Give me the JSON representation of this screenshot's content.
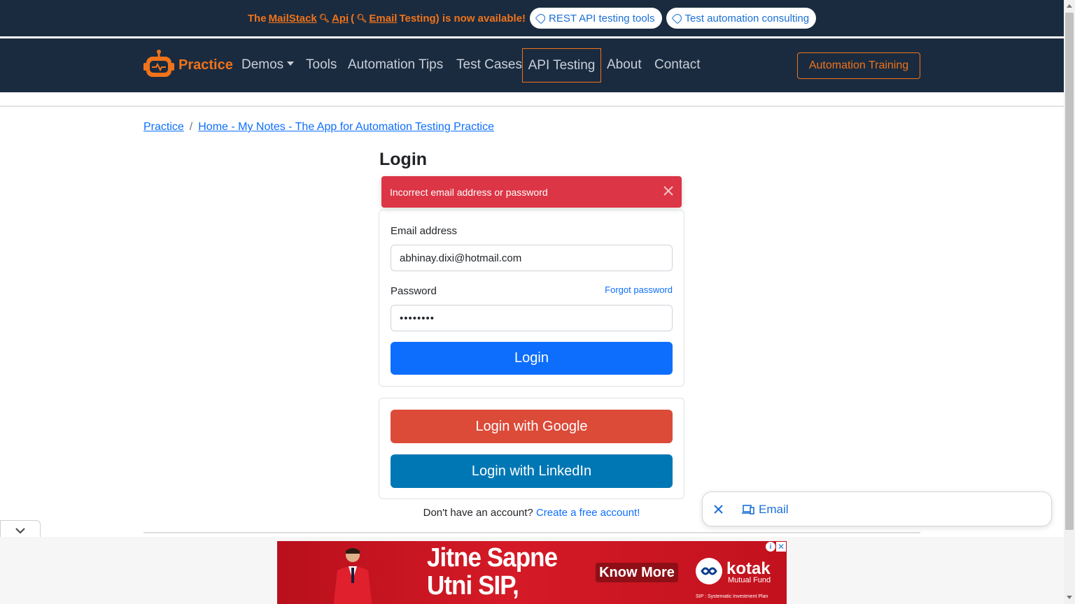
{
  "promo": {
    "text_prefix": "The",
    "mailstack": "MailStack",
    "api": "Api",
    "email_testing": "Email",
    "text_suffix": "Testing) is now available!",
    "paren_open": "(",
    "pill_1": "REST API testing tools",
    "pill_2": "Test automation consulting"
  },
  "nav": {
    "brand": "Practice",
    "items": [
      "Demos",
      "Tools",
      "Automation Tips",
      "Test Cases",
      "API Testing",
      "About",
      "Contact"
    ],
    "training_button": "Automation Training"
  },
  "breadcrumb": {
    "items": [
      "Practice",
      "Home - My Notes - The App for Automation Testing Practice"
    ],
    "separator": "/"
  },
  "login": {
    "title": "Login",
    "toast_message": "Incorrect email address or password",
    "email_label": "Email address",
    "email_value": "abhinay.dixi@hotmail.com",
    "password_label": "Password",
    "forgot_password": "Forgot password",
    "password_value": "••••••••",
    "submit": "Login",
    "google": "Login with Google",
    "linkedin": "Login with LinkedIn",
    "signup_prompt": "Don't have an account?",
    "signup_link": "Create a free account!"
  },
  "email_popup": {
    "label": "Email"
  },
  "ad": {
    "headline": "Jitne Sapne\nUtni SIP,",
    "cta": "Know More",
    "brand": "kotak",
    "brand_sub": "Mutual Fund",
    "fine_print": "SIP : Systematic Investment Plan"
  },
  "colors": {
    "nav_bg": "#1a2b3f",
    "accent_orange": "#f0731b",
    "primary_blue": "#0d6efd",
    "toast_red": "#dc3545",
    "google_red": "#dc4a38",
    "linkedin_blue": "#0077b5"
  }
}
